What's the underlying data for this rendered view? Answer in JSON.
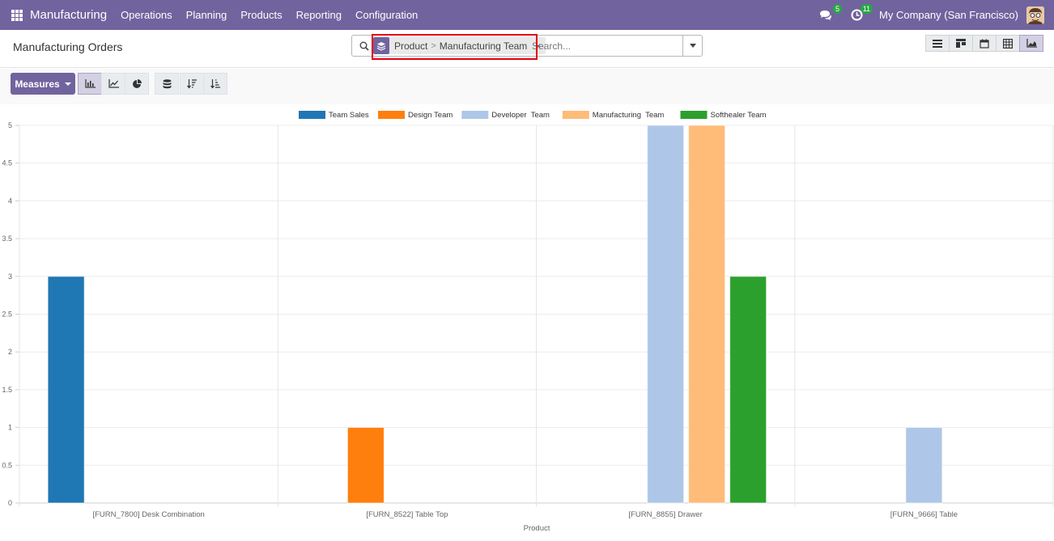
{
  "navbar": {
    "brand": "Manufacturing",
    "menu": [
      "Operations",
      "Planning",
      "Products",
      "Reporting",
      "Configuration"
    ],
    "messages_count": "5",
    "activities_count": "11",
    "company": "My Company (San Francisco)"
  },
  "control": {
    "title": "Manufacturing Orders",
    "facet": {
      "field1": "Product",
      "separator": ">",
      "field2": "Manufacturing Team",
      "close": "×"
    },
    "search_placeholder": "Search..."
  },
  "toolbar": {
    "measures_label": "Measures"
  },
  "colors": {
    "navbar": "#71639e",
    "accent": "#71639e",
    "highlight": "#e3000f"
  },
  "chart_data": {
    "type": "bar",
    "categories": [
      "[FURN_7800] Desk Combination",
      "[FURN_8522] Table Top",
      "[FURN_8855] Drawer",
      "[FURN_9666] Table"
    ],
    "series": [
      {
        "name": "Team Sales",
        "color": "#1f77b4",
        "values": [
          3,
          0,
          0,
          0
        ]
      },
      {
        "name": "Design Team",
        "color": "#ff7f0e",
        "values": [
          0,
          1,
          0,
          0
        ]
      },
      {
        "name": "Developer  Team",
        "color": "#aec7e8",
        "values": [
          0,
          0,
          5,
          1
        ]
      },
      {
        "name": "Manufacturing  Team",
        "color": "#ffbb78",
        "values": [
          0,
          0,
          5,
          0
        ]
      },
      {
        "name": "Softhealer Team",
        "color": "#2ca02c",
        "values": [
          0,
          0,
          3,
          0
        ]
      }
    ],
    "y_ticks": [
      "0",
      "0.5",
      "1",
      "1.5",
      "2",
      "2.5",
      "3",
      "3.5",
      "4",
      "4.5",
      "5"
    ],
    "xlabel": "Product",
    "ylabel": "",
    "ylim": [
      0,
      5
    ],
    "legend": "top",
    "grid": true
  }
}
